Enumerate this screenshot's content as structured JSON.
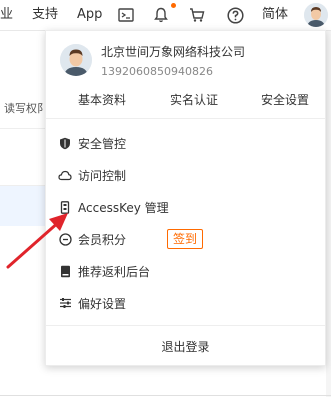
{
  "topbar": {
    "partial_item": "业",
    "support": "支持",
    "app": "App",
    "language": "简体",
    "icons": [
      "terminal-icon",
      "bell-icon",
      "cart-icon",
      "help-icon",
      "avatar"
    ]
  },
  "background": {
    "partial_text": "读写权阝"
  },
  "profile": {
    "company": "北京世间万象网络科技公司",
    "account_id": "1392060850940826"
  },
  "tabs": [
    "基本资料",
    "实名认证",
    "安全设置"
  ],
  "menu": {
    "security": "安全管控",
    "access": "访问控制",
    "accesskey": "AccessKey 管理",
    "points": "会员积分",
    "signin": "签到",
    "rebate": "推荐返利后台",
    "prefs": "偏好设置"
  },
  "logout": "退出登录",
  "colors": {
    "accent": "#ff6a00",
    "annotation_arrow": "#e0242b"
  }
}
